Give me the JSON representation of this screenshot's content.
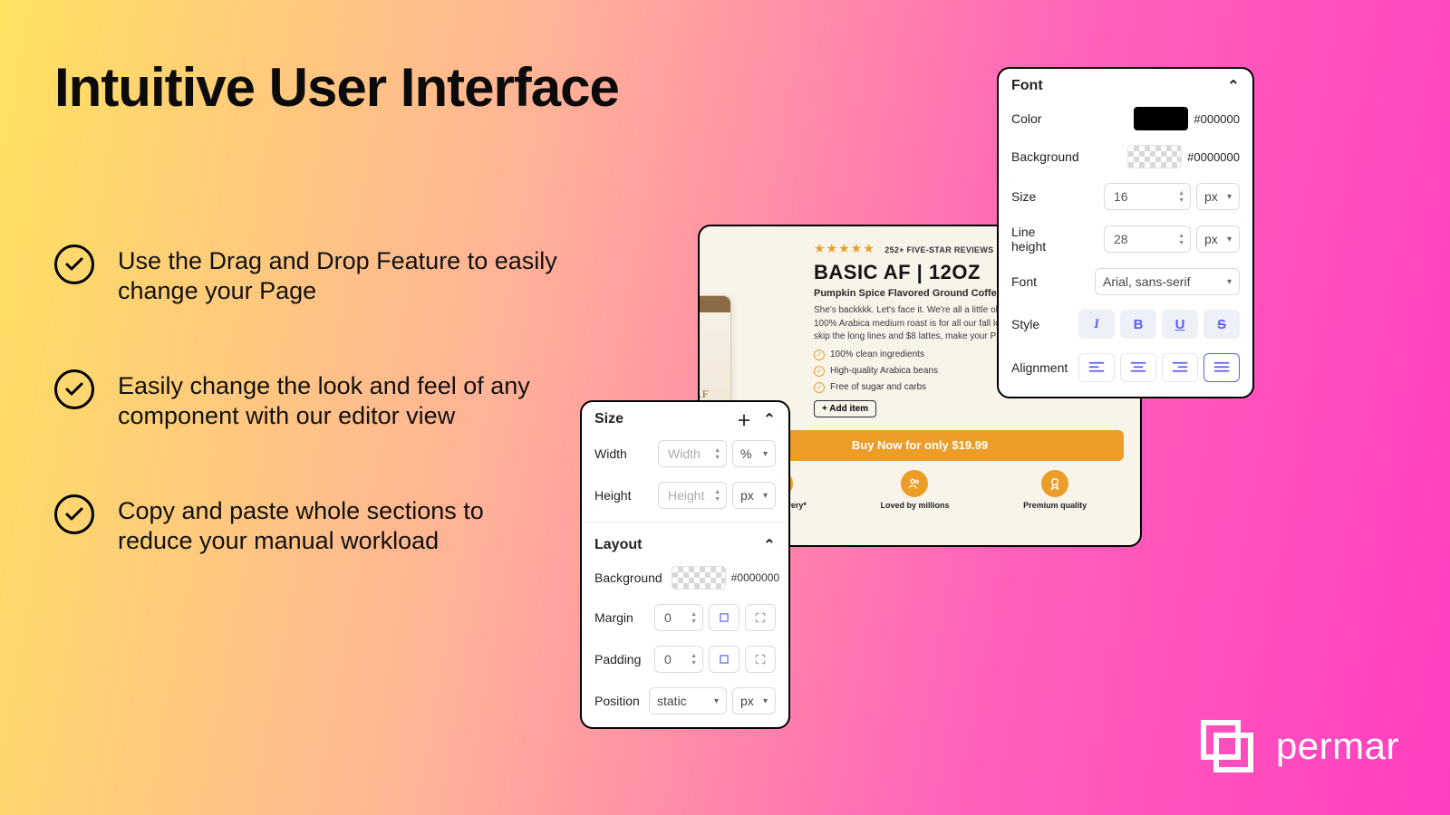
{
  "page": {
    "title": "Intuitive User Interface"
  },
  "bullets": [
    "Use the Drag and Drop Feature to easily change your Page",
    "Easily change the look and feel of any component with our editor view",
    "Copy and paste whole sections to reduce your manual workload"
  ],
  "fontPanel": {
    "title": "Font",
    "colorLabel": "Color",
    "colorValue": "#000000",
    "backgroundLabel": "Background",
    "backgroundValue": "#0000000",
    "sizeLabel": "Size",
    "sizeValue": "16",
    "sizeUnit": "px",
    "lineHeightLabel": "Line height",
    "lineHeightValue": "28",
    "lineHeightUnit": "px",
    "fontLabel": "Font",
    "fontValue": "Arial, sans-serif",
    "styleLabel": "Style",
    "alignmentLabel": "Alignment"
  },
  "sizePanel": {
    "title": "Size",
    "widthLabel": "Width",
    "widthPlaceholder": "Width",
    "widthUnit": "%",
    "heightLabel": "Height",
    "heightPlaceholder": "Height",
    "heightUnit": "px",
    "layoutTitle": "Layout",
    "backgroundLabel": "Background",
    "backgroundValue": "#0000000",
    "marginLabel": "Margin",
    "marginValue": "0",
    "paddingLabel": "Padding",
    "paddingValue": "0",
    "positionLabel": "Position",
    "positionValue": "static",
    "positionUnit": "px"
  },
  "product": {
    "reviewsLine": "252+ FIVE-STAR REVIEWS",
    "title": "BASIC AF | 12OZ",
    "subtitle": "Pumpkin Spice Flavored Ground Coffee",
    "desc": "She's backkkk. Let's face it. We're all a little obsessed on the season. This 100% Arabica medium roast is for all our fall loving coffee lovers who can skip the long lines and $8 lattes, make your PSL at home.",
    "features": [
      "100% clean ingredients",
      "High-quality Arabica beans",
      "Free of sugar and carbs"
    ],
    "addItem": "+ Add item",
    "buy": "Buy Now for only $19.99",
    "badges": [
      "Free delivery*",
      "Loved by millions",
      "Premium quality"
    ],
    "bagLabel": "BASIC AF"
  },
  "logo": {
    "text": "permar"
  }
}
